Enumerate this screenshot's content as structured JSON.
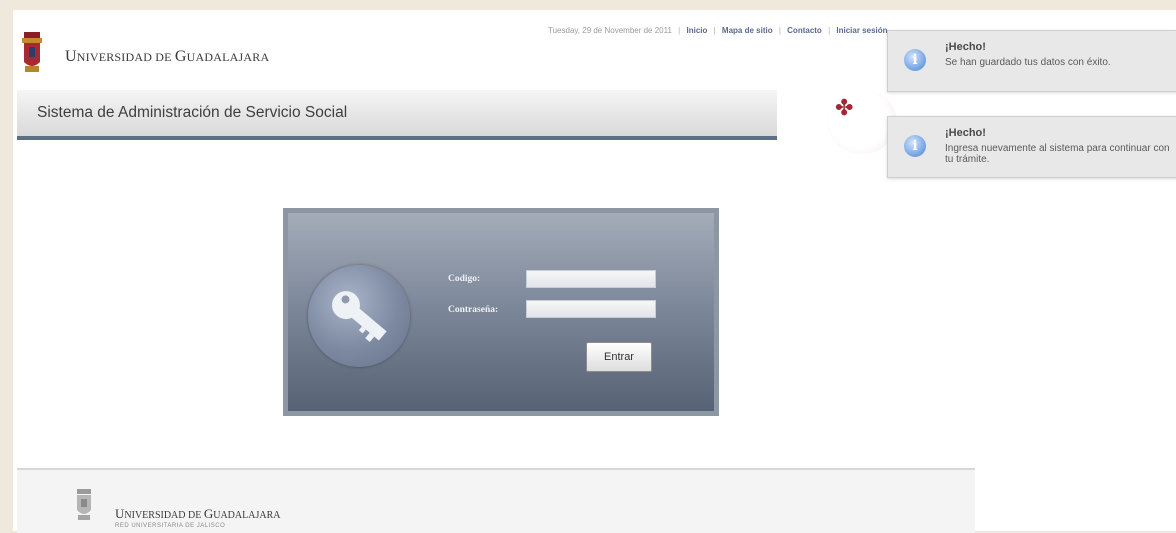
{
  "header": {
    "university_name_initial": "U",
    "university_name_rest": "NIVERSIDAD DE ",
    "university_name_g": "G",
    "university_name_rest2": "UADALAJARA",
    "date_text": "Tuesday, 29 de November de 2011",
    "nav": {
      "inicio": "Inicio",
      "mapa": "Mapa de sitio",
      "contacto": "Contacto",
      "iniciar_sesion": "Iniciar sesión"
    }
  },
  "title_bar": {
    "title": "Sistema de Administración de Servicio Social"
  },
  "login": {
    "codigo_label": "Codigo:",
    "codigo_value": "",
    "contrasena_label": "Contraseña:",
    "contrasena_value": "",
    "submit_label": "Entrar"
  },
  "notifications": [
    {
      "title": "¡Hecho!",
      "message": "Se han guardado tus datos con éxito.",
      "icon": "info-icon"
    },
    {
      "title": "¡Hecho!",
      "message": "Ingresa nuevamente al sistema para continuar con tu trámite.",
      "icon": "info-icon"
    }
  ],
  "footer": {
    "university_name_initial": "U",
    "university_name_rest": "NIVERSIDAD DE ",
    "university_name_g": "G",
    "university_name_rest2": "UADALAJARA",
    "subtitle": "RED UNIVERSITARIA DE JALISCO"
  },
  "colors": {
    "accent_bar": "#5d6f85",
    "login_panel": "#7e899b",
    "emblem_red": "#a22633",
    "info_blue": "#6f9fe2"
  }
}
